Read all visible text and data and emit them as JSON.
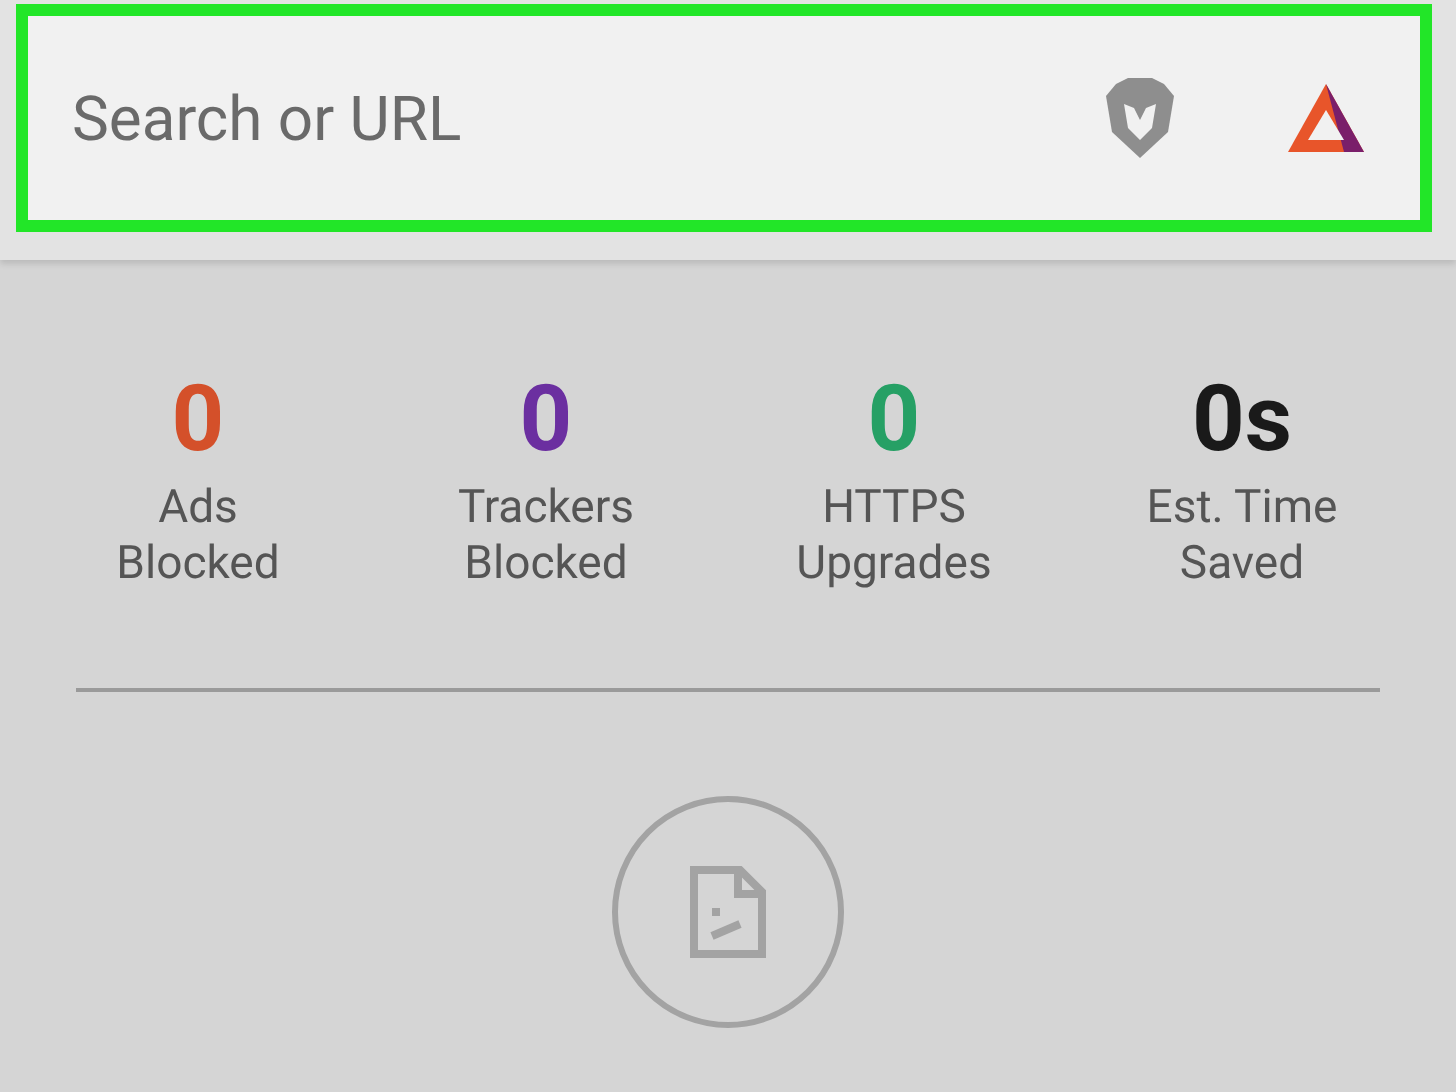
{
  "address_bar": {
    "placeholder": "Search or URL"
  },
  "stats": [
    {
      "value": "0",
      "label": "Ads Blocked",
      "color": "#d4502a"
    },
    {
      "value": "0",
      "label": "Trackers Blocked",
      "color": "#6b2fa0"
    },
    {
      "value": "0",
      "label": "HTTPS Upgrades",
      "color": "#26a065"
    },
    {
      "value": "0s",
      "label": "Est. Time Saved",
      "color": "#1a1a1a"
    }
  ]
}
